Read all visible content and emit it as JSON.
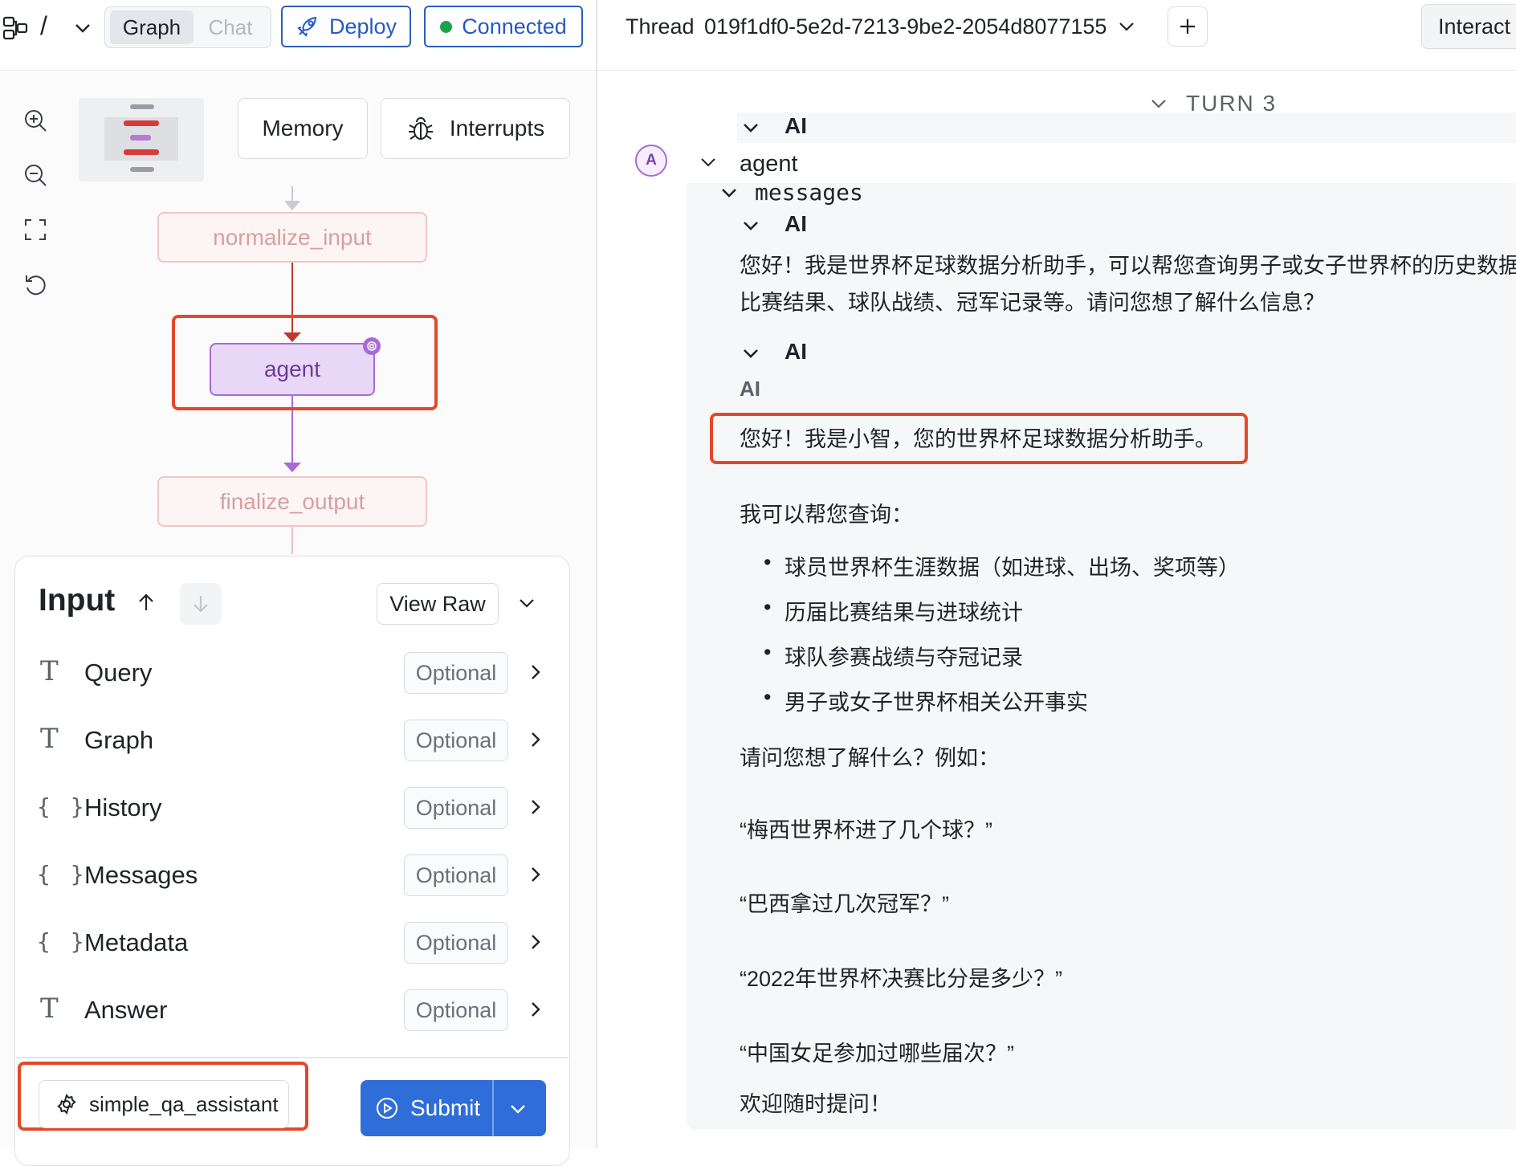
{
  "topbar": {
    "breadcrumb_sep": "/",
    "tabs": [
      {
        "label": "Graph",
        "active": true
      },
      {
        "label": "Chat",
        "active": false
      }
    ],
    "deploy_label": "Deploy",
    "connected_label": "Connected",
    "thread_label": "Thread",
    "thread_id": "019f1df0-5e2d-7213-9be2-2054d8077155",
    "interact_label": "Interact"
  },
  "graph": {
    "memory_label": "Memory",
    "interrupts_label": "Interrupts",
    "nodes": [
      "normalize_input",
      "agent",
      "finalize_output"
    ]
  },
  "input_panel": {
    "title": "Input",
    "view_raw_label": "View Raw",
    "fields": [
      {
        "type": "text",
        "label": "Query",
        "badge": "Optional"
      },
      {
        "type": "text",
        "label": "Graph",
        "badge": "Optional"
      },
      {
        "type": "object",
        "label": "History",
        "badge": "Optional"
      },
      {
        "type": "object",
        "label": "Messages",
        "badge": "Optional"
      },
      {
        "type": "object",
        "label": "Metadata",
        "badge": "Optional"
      },
      {
        "type": "text",
        "label": "Answer",
        "badge": "Optional"
      }
    ],
    "assistant_label": "simple_qa_assistant",
    "submit_label": "Submit"
  },
  "thread": {
    "turn_label": "TURN 3",
    "ai_label": "AI",
    "avatar_letter": "A",
    "agent_label": "agent",
    "messages_label": "messages",
    "message1_line1": "您好！我是世界杯足球数据分析助手，可以帮您查询男子或女子世界杯的历史数据",
    "message1_line2": "比赛结果、球队战绩、冠军记录等。请问您想了解什么信息？",
    "message2_sub": "AI",
    "message2_intro": "您好！我是小智，您的世界杯足球数据分析助手。",
    "message2_can": "我可以帮您查询：",
    "bullets": [
      "球员世界杯生涯数据（如进球、出场、奖项等）",
      "历届比赛结果与进球统计",
      "球队参赛战绩与夺冠记录",
      "男子或女子世界杯相关公开事实"
    ],
    "ask": "请问您想了解什么？例如：",
    "examples": [
      "“梅西世界杯进了几个球？”",
      "“巴西拿过几次冠军？”",
      "“2022年世界杯决赛比分是多少？”",
      "“中国女足参加过哪些届次？”"
    ],
    "closing": "欢迎随时提问！"
  },
  "colors": {
    "accent": "#2659c4",
    "highlight": "#e2492b",
    "agent": "#a86ad6",
    "connected": "#1aa34a"
  }
}
